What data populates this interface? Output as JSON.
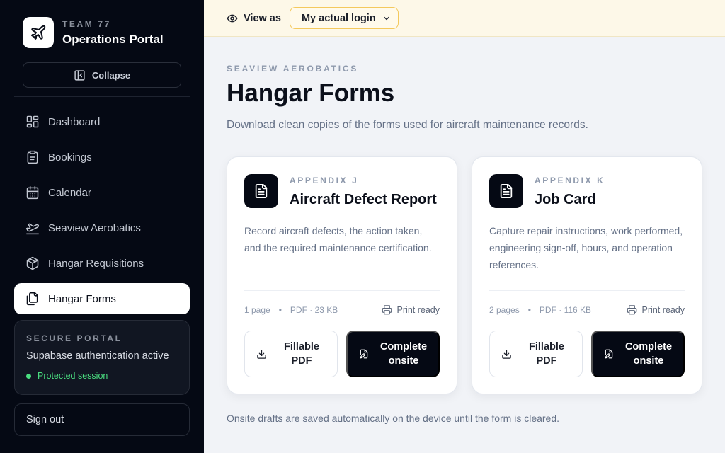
{
  "sidebar": {
    "team": "TEAM 77",
    "app_name": "Operations Portal",
    "collapse_label": "Collapse",
    "items": [
      {
        "label": "Dashboard",
        "icon": "dashboard-icon",
        "active": false
      },
      {
        "label": "Bookings",
        "icon": "clipboard-icon",
        "active": false
      },
      {
        "label": "Calendar",
        "icon": "calendar-icon",
        "active": false
      },
      {
        "label": "Seaview Aerobatics",
        "icon": "plane-takeoff-icon",
        "active": false
      },
      {
        "label": "Hangar Requisitions",
        "icon": "package-icon",
        "active": false
      },
      {
        "label": "Hangar Forms",
        "icon": "files-icon",
        "active": true
      }
    ],
    "secure": {
      "title": "SECURE PORTAL",
      "text": "Supabase authentication active",
      "status": "Protected session"
    },
    "signout_label": "Sign out"
  },
  "topbar": {
    "view_as_label": "View as",
    "view_as_value": "My actual login"
  },
  "main": {
    "eyebrow": "SEAVIEW AEROBATICS",
    "title": "Hangar Forms",
    "subtitle": "Download clean copies of the forms used for aircraft maintenance records.",
    "cards": [
      {
        "label": "APPENDIX J",
        "title": "Aircraft Defect Report",
        "description": "Record aircraft defects, the action taken, and the required maintenance certification.",
        "pages": "1 page",
        "format": "PDF · 23 KB",
        "print_label": "Print ready",
        "fillable_label": "Fillable PDF",
        "complete_label": "Complete onsite"
      },
      {
        "label": "APPENDIX K",
        "title": "Job Card",
        "description": "Capture repair instructions, work performed, engineering sign-off, hours, and operation references.",
        "pages": "2 pages",
        "format": "PDF · 116 KB",
        "print_label": "Print ready",
        "fillable_label": "Fillable PDF",
        "complete_label": "Complete onsite"
      }
    ],
    "footnote": "Onsite drafts are saved automatically on the device until the form is cleared."
  },
  "colors": {
    "sidebar_bg": "#050914",
    "topbar_bg": "#fdf8e8",
    "accent_border": "#f4c95d",
    "status_green": "#4ade80"
  }
}
